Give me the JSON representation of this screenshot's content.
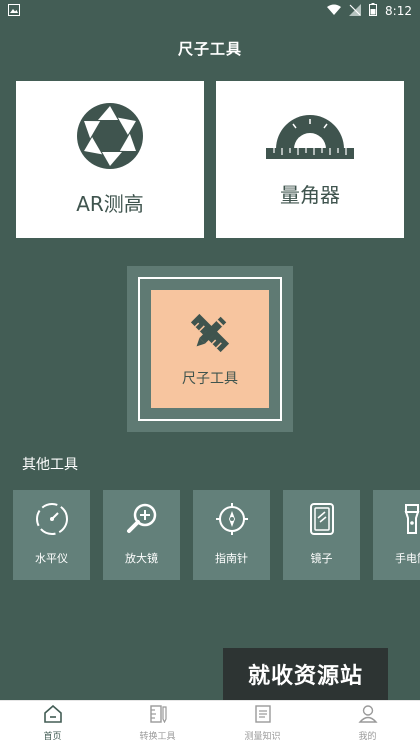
{
  "status_bar": {
    "time": "8:12"
  },
  "header": {
    "title": "尺子工具"
  },
  "main_cards": {
    "ar": {
      "label": "AR测高",
      "icon": "camera-aperture-icon"
    },
    "protractor": {
      "label": "量角器",
      "icon": "protractor-icon"
    },
    "ruler": {
      "label": "尺子工具",
      "icon": "pencil-ruler-icon"
    }
  },
  "other_tools": {
    "title": "其他工具",
    "items": [
      {
        "label": "水平仪",
        "icon": "level-gauge-icon"
      },
      {
        "label": "放大镜",
        "icon": "magnifier-icon"
      },
      {
        "label": "指南针",
        "icon": "compass-icon"
      },
      {
        "label": "镜子",
        "icon": "mirror-icon"
      },
      {
        "label": "手电筒",
        "icon": "flashlight-icon"
      }
    ]
  },
  "watermark": {
    "text": "就收资源站"
  },
  "bottom_nav": {
    "items": [
      {
        "label": "首页",
        "icon": "home-icon",
        "active": true
      },
      {
        "label": "转换工具",
        "icon": "convert-tools-icon",
        "active": false
      },
      {
        "label": "测量知识",
        "icon": "document-icon",
        "active": false
      },
      {
        "label": "我的",
        "icon": "person-icon",
        "active": false
      }
    ]
  },
  "colors": {
    "background": "#435d55",
    "card": "#ffffff",
    "ruler_card": "#f7c59f",
    "tool_tile": "#63807a",
    "icon_dark": "#3f544e"
  }
}
